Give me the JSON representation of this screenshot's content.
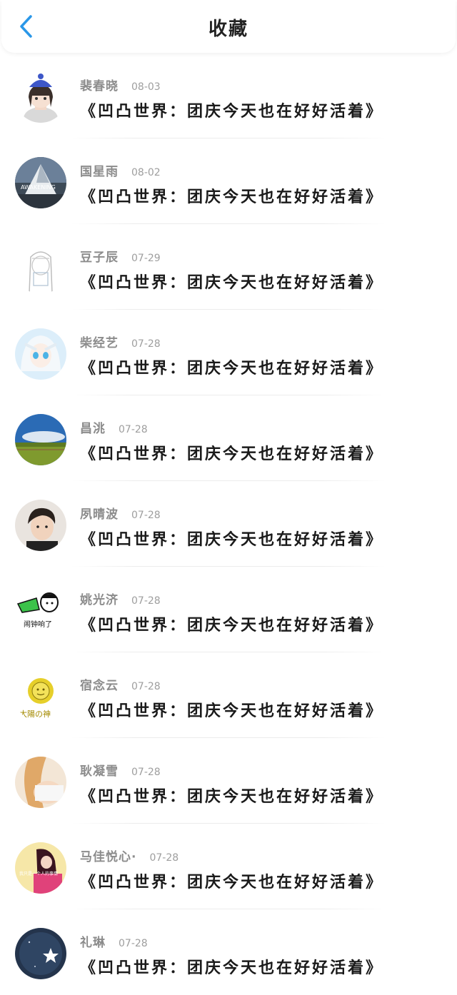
{
  "header": {
    "title": "收藏",
    "back_icon": "chevron-left-icon",
    "accent": "#2a97e8"
  },
  "items": [
    {
      "name": "裴春晓",
      "date": "08-03",
      "book": "《凹凸世界：团庆今天也在好好活着》",
      "avatar_icon": "anime-girl-blue-hat-avatar"
    },
    {
      "name": "国星雨",
      "date": "08-02",
      "book": "《凹凸世界：团庆今天也在好好活着》",
      "avatar_icon": "awakening-mountain-avatar",
      "avatar_text": "AWAKENING"
    },
    {
      "name": "豆子辰",
      "date": "07-29",
      "book": "《凹凸世界：团庆今天也在好好活着》",
      "avatar_icon": "sketch-girl-avatar"
    },
    {
      "name": "柴经艺",
      "date": "07-28",
      "book": "《凹凸世界：团庆今天也在好好活着》",
      "avatar_icon": "anime-white-hair-avatar"
    },
    {
      "name": "昌洮",
      "date": "07-28",
      "book": "《凹凸世界：团庆今天也在好好活着》",
      "avatar_icon": "landscape-sky-avatar"
    },
    {
      "name": "夙晴波",
      "date": "07-28",
      "book": "《凹凸世界：团庆今天也在好好活着》",
      "avatar_icon": "boy-photo-avatar"
    },
    {
      "name": "姚光济",
      "date": "07-28",
      "book": "《凹凸世界：团庆今天也在好好活着》",
      "avatar_icon": "cartoon-alarm-avatar",
      "avatar_text": "闹钟响了"
    },
    {
      "name": "宿念云",
      "date": "07-28",
      "book": "《凹凸世界：团庆今天也在好好活着》",
      "avatar_icon": "sun-god-avatar",
      "avatar_text": "太陽の神"
    },
    {
      "name": "耿凝雪",
      "date": "07-28",
      "book": "《凹凸世界：团庆今天也在好好活着》",
      "avatar_icon": "girl-back-photo-avatar"
    },
    {
      "name": "马佳悦心·",
      "date": "07-28",
      "book": "《凹凸世界：团庆今天也在好好活着》",
      "avatar_icon": "pink-girl-avatar",
      "avatar_text": "我只是一个人的事情"
    },
    {
      "name": "礼琳",
      "date": "07-28",
      "book": "《凹凸世界：团庆今天也在好好活着》",
      "avatar_icon": "night-star-avatar"
    }
  ]
}
